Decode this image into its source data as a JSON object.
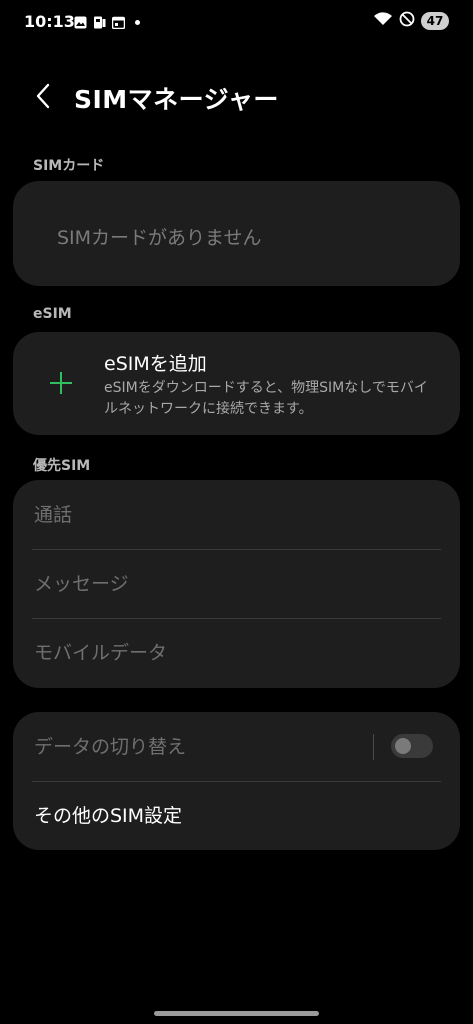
{
  "status_bar": {
    "time": "10:13",
    "battery": "47",
    "icons": [
      "gallery-icon",
      "sim-toolkit-icon",
      "calendar-icon",
      "dot-icon",
      "wifi-icon",
      "do-not-disturb-icon"
    ]
  },
  "header": {
    "title": "SIMマネージャー"
  },
  "sim_card_section": {
    "label": "SIMカード",
    "empty_text": "SIMカードがありません"
  },
  "esim_section": {
    "label": "eSIM",
    "add_title": "eSIMを追加",
    "add_description": "eSIMをダウンロードすると、物理SIMなしでモバイルネットワークに接続できます。"
  },
  "preferred_sim_section": {
    "label": "優先SIM",
    "items": [
      {
        "label": "通話"
      },
      {
        "label": "メッセージ"
      },
      {
        "label": "モバイルデータ"
      }
    ]
  },
  "other_section": {
    "data_switch_label": "データの切り替え",
    "data_switch_enabled": false,
    "other_settings_label": "その他のSIM設定"
  },
  "colors": {
    "background": "#000000",
    "card": "#1e1e1e",
    "accent_green": "#2fbf5f",
    "disabled_text": "#6f6f6f"
  }
}
